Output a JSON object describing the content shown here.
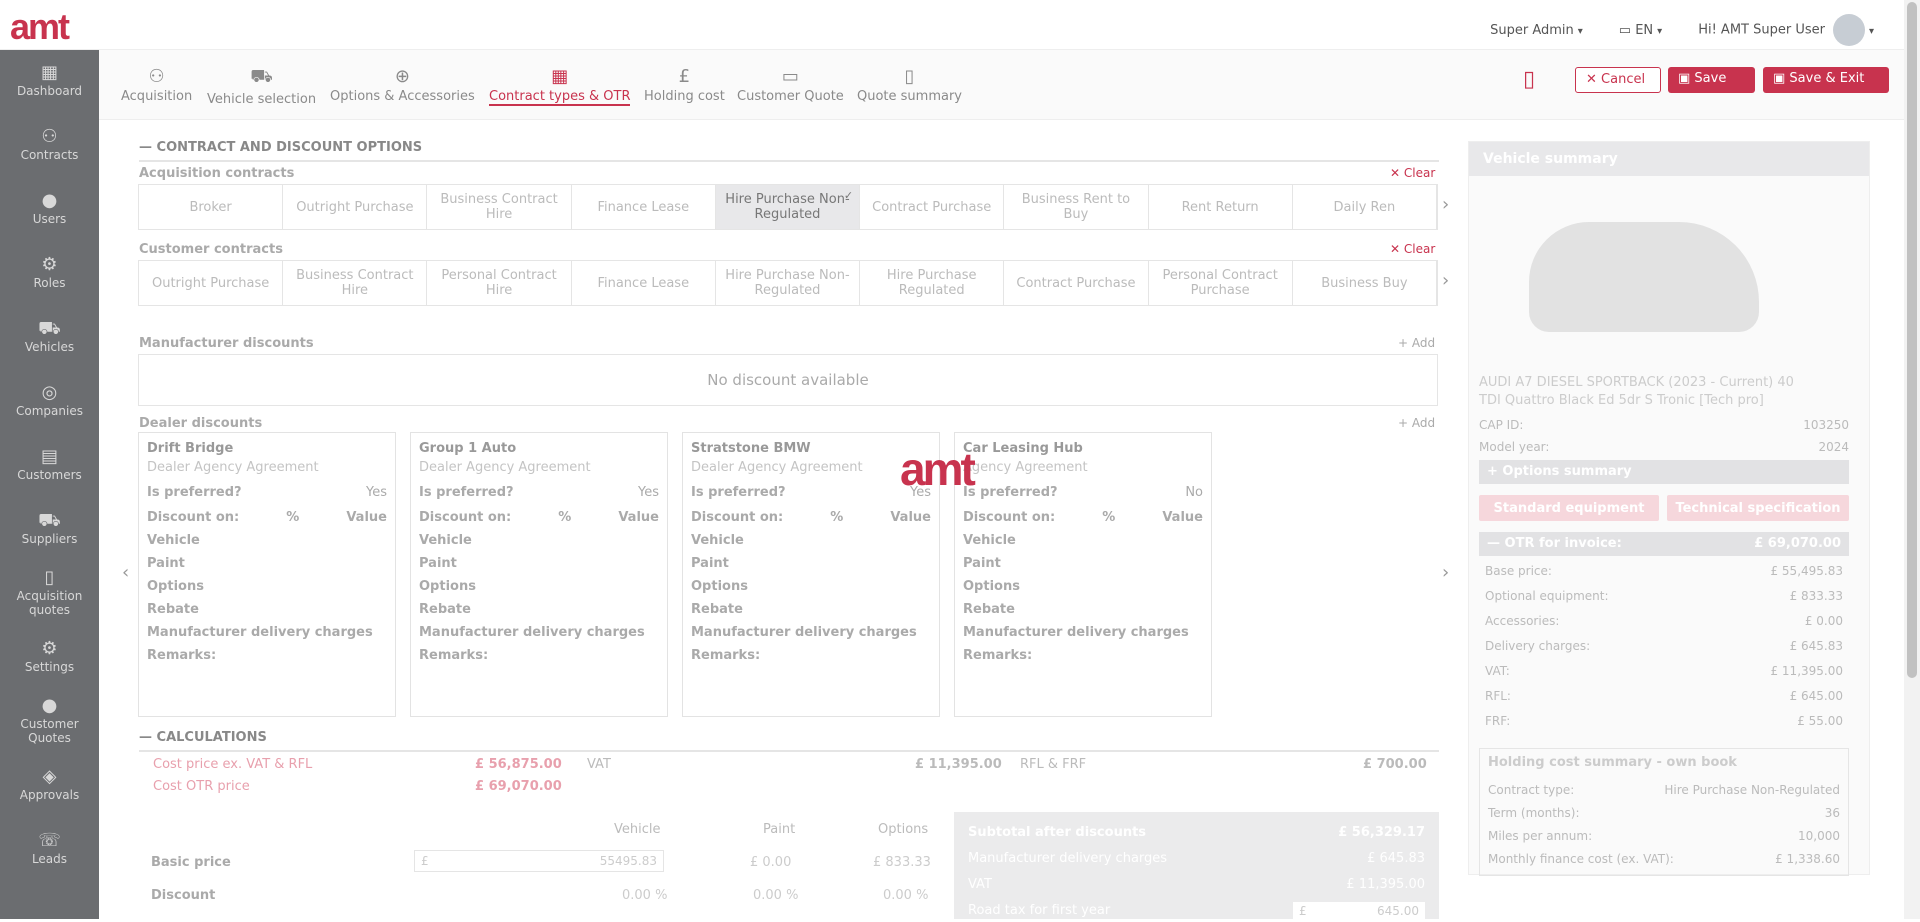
{
  "app": {
    "logo": "amt",
    "user_role": "Super Admin",
    "language": "EN",
    "greeting": "Hi! AMT Super User"
  },
  "sidebar": [
    "Dashboard",
    "Contracts",
    "Users",
    "Roles",
    "Vehicles",
    "Companies",
    "Customers",
    "Suppliers",
    "Acquisition quotes",
    "Settings",
    "Customer Quotes",
    "Approvals",
    "Leads"
  ],
  "steps": [
    "Acquisition",
    "Vehicle selection",
    "Options & Accessories",
    "Contract types & OTR",
    "Holding cost",
    "Customer Quote",
    "Quote summary"
  ],
  "actions": {
    "cancel": "Cancel",
    "save": "Save",
    "save_exit": "Save & Exit"
  },
  "contract_section": {
    "title": "CONTRACT AND DISCOUNT OPTIONS",
    "acq_title": "Acquisition contracts",
    "clear": "Clear",
    "acq_tabs": [
      "Broker",
      "Outright Purchase",
      "Business Contract Hire",
      "Finance Lease",
      "Hire Purchase Non-Regulated",
      "Contract Purchase",
      "Business Rent to Buy",
      "Rent Return",
      "Daily Ren"
    ],
    "cust_title": "Customer contracts",
    "cust_tabs": [
      "Outright Purchase",
      "Business Contract Hire",
      "Personal Contract Hire",
      "Finance Lease",
      "Hire Purchase Non-Regulated",
      "Hire Purchase Regulated",
      "Contract Purchase",
      "Personal Contract Purchase",
      "Business Buy"
    ],
    "manu_title": "Manufacturer discounts",
    "add": "Add",
    "no_discount": "No discount available",
    "dealer_title": "Dealer discounts"
  },
  "dealers": [
    {
      "name": "Drift Bridge",
      "agreement": "Dealer Agency Agreement",
      "preferred": "Yes"
    },
    {
      "name": "Group 1 Auto",
      "agreement": "Dealer Agency Agreement",
      "preferred": "Yes"
    },
    {
      "name": "Stratstone BMW",
      "agreement": "Dealer Agency Agreement",
      "preferred": "Yes"
    },
    {
      "name": "Car Leasing Hub",
      "agreement": "Agency Agreement",
      "preferred": "No"
    }
  ],
  "dealer_labels": {
    "preferred": "Is preferred?",
    "discount_on": "Discount on:",
    "pct": "%",
    "value": "Value",
    "vehicle": "Vehicle",
    "paint": "Paint",
    "options": "Options",
    "rebate": "Rebate",
    "mdc": "Manufacturer delivery charges",
    "remarks": "Remarks:"
  },
  "calc": {
    "title": "CALCULATIONS",
    "cost_ex_label": "Cost price ex. VAT & RFL",
    "cost_ex": "£ 56,875.00",
    "vat_label": "VAT",
    "vat": "£ 11,395.00",
    "rfl_label": "RFL & FRF",
    "rfl": "£ 700.00",
    "otr_label": "Cost OTR price",
    "otr": "£ 69,070.00",
    "col_vehicle": "Vehicle",
    "col_paint": "Paint",
    "col_options": "Options",
    "basic_label": "Basic price",
    "basic_vehicle": "55495.83",
    "basic_paint": "£ 0.00",
    "basic_options": "£ 833.33",
    "basic_vehicle_prefix": "£",
    "discount_label": "Discount",
    "disc_v": "0.00 %",
    "disc_p": "0.00 %",
    "disc_o": "0.00 %",
    "subtotal_label": "Subtotal after discounts",
    "subtotal": "£ 56,329.17",
    "mdc_label": "Manufacturer delivery charges",
    "mdc": "£ 645.83",
    "vat2_label": "VAT",
    "vat2": "£ 11,395.00",
    "roadtax_label": "Road tax for first year",
    "roadtax": "645.00",
    "roadtax_prefix": "£"
  },
  "vehicle_summary": {
    "title": "Vehicle summary",
    "model": "AUDI A7 DIESEL SPORTBACK (2023 - Current) 40 TDI Quattro Black Ed 5dr S Tronic [Tech pro]",
    "cap_label": "CAP ID:",
    "cap": "103250",
    "year_label": "Model year:",
    "year": "2024",
    "options_summary": "Options summary",
    "std_eq": "Standard equipment",
    "tech_spec": "Technical specification",
    "otr_label": "OTR for invoice:",
    "otr": "£ 69,070.00",
    "otr_rows": [
      {
        "k": "Base price:",
        "v": "£ 55,495.83"
      },
      {
        "k": "Optional equipment:",
        "v": "£ 833.33"
      },
      {
        "k": "Accessories:",
        "v": "£ 0.00"
      },
      {
        "k": "Delivery charges:",
        "v": "£ 645.83"
      },
      {
        "k": "VAT:",
        "v": "£ 11,395.00"
      },
      {
        "k": "RFL:",
        "v": "£ 645.00"
      },
      {
        "k": "FRF:",
        "v": "£ 55.00"
      }
    ],
    "holding_title": "Holding cost summary - own book",
    "holding_rows": [
      {
        "k": "Contract type:",
        "v": "Hire Purchase Non-Regulated"
      },
      {
        "k": "Term (months):",
        "v": "36"
      },
      {
        "k": "Miles per annum:",
        "v": "10,000"
      },
      {
        "k": "Monthly finance cost (ex. VAT):",
        "v": "£ 1,338.60"
      }
    ]
  },
  "colors": {
    "accent": "#c8334e"
  }
}
